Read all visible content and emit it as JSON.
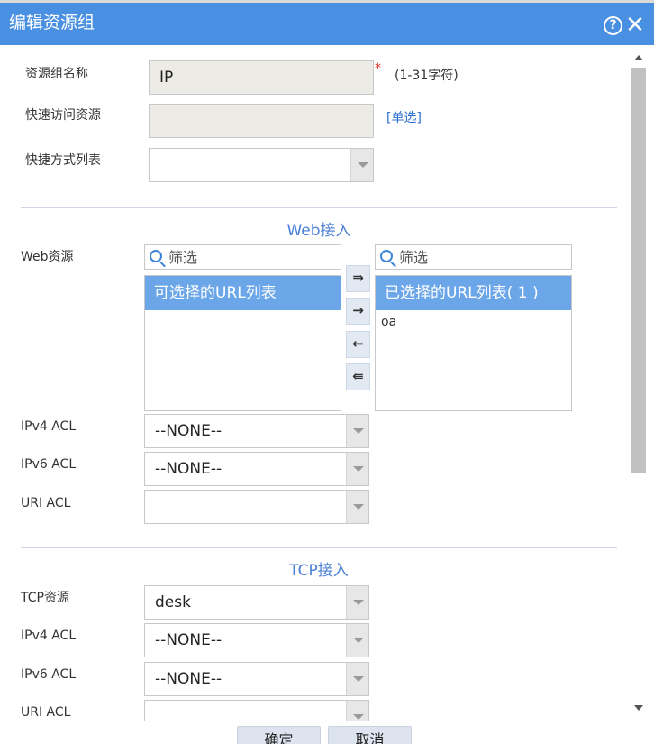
{
  "dialog": {
    "title": "编辑资源组",
    "help_icon": "?",
    "close_icon": "✕"
  },
  "basic": {
    "name_label": "资源组名称",
    "name_value": "IP",
    "required_mark": "*",
    "name_hint": "(1-31字符)",
    "quick_access_label": "快速访问资源",
    "quick_access_value": "",
    "single_select_link": "[单选]",
    "shortcut_label": "快捷方式列表",
    "shortcut_value": ""
  },
  "web": {
    "section_title": "Web接入",
    "resource_label": "Web资源",
    "filter_placeholder": "筛选",
    "available_header": "可选择的URL列表",
    "selected_header": "已选择的URL列表( 1 )",
    "selected_items": [
      "oa"
    ],
    "move_all_right": "⇛",
    "move_right": "→",
    "move_left": "←",
    "move_all_left": "⇚",
    "ipv4_label": "IPv4 ACL",
    "ipv4_value": "--NONE--",
    "ipv6_label": "IPv6 ACL",
    "ipv6_value": "--NONE--",
    "uri_label": "URI ACL",
    "uri_value": ""
  },
  "tcp": {
    "section_title": "TCP接入",
    "resource_label": "TCP资源",
    "resource_value": "desk",
    "ipv4_label": "IPv4 ACL",
    "ipv4_value": "--NONE--",
    "ipv6_label": "IPv6 ACL",
    "ipv6_value": "--NONE--",
    "uri_label": "URI ACL",
    "uri_value": ""
  },
  "footer": {
    "ok_label": "确定",
    "cancel_label": "取消"
  },
  "colors": {
    "title_bar": "#4a90e2",
    "list_header": "#6ba6e8",
    "section_title": "#4a7fd6",
    "required": "#e0251c",
    "link": "#2b6fd3"
  }
}
